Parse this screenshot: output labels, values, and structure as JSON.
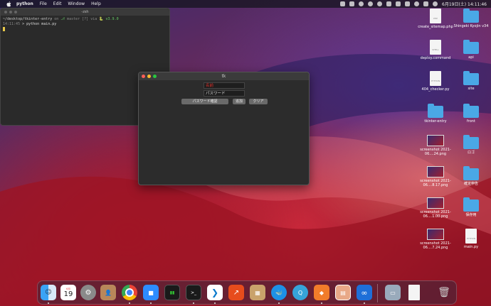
{
  "menubar": {
    "app": "python",
    "items": [
      "File",
      "Edit",
      "Window",
      "Help"
    ],
    "datetime": "6月19日(土)  14:11:46"
  },
  "terminal": {
    "title": "-zsh",
    "line1_path": "~/desktop/tkinter-entry",
    "line1_on": "on",
    "line1_branch": "master [?] via",
    "line1_py": "v3.9.0",
    "line2_time": "14:11:45",
    "line2_cmd": "> python main.py"
  },
  "tk": {
    "title": "tk",
    "entry1": "名前",
    "entry2": "パスワード",
    "btn_confirm": "パスワード確認",
    "btn_add": "追加",
    "btn_clear": "クリア",
    "colors": {
      "entry1_text": "#e0302a",
      "entry2_text": "#dddddd"
    }
  },
  "desktop": [
    {
      "label": "create_sitemap.php",
      "type": "file",
      "tag": "PHP"
    },
    {
      "label": "Shingeki Kyojin v34",
      "type": "folder"
    },
    {
      "label": "deploy.command",
      "type": "file",
      "tag": "SHELL"
    },
    {
      "label": "api",
      "type": "folder"
    },
    {
      "label": "404_checker.py",
      "type": "file",
      "tag": "PYTHON"
    },
    {
      "label": "site",
      "type": "folder"
    },
    {
      "label": "tkinter-entry",
      "type": "folder"
    },
    {
      "label": "front",
      "type": "folder"
    },
    {
      "label": "screenshot 2021-06....24.png",
      "type": "shot"
    },
    {
      "label": "ロゴ",
      "type": "folder"
    },
    {
      "label": "screenshot 2021-06....8.17.png",
      "type": "shot"
    },
    {
      "label": "確定申告",
      "type": "folder"
    },
    {
      "label": "screenshot 2021-06....1.00.png",
      "type": "shot"
    },
    {
      "label": "保存用",
      "type": "folder"
    },
    {
      "label": "screenshot 2021-06....7.24.png",
      "type": "shot"
    },
    {
      "label": "main.py",
      "type": "file",
      "tag": "PYTHON"
    }
  ],
  "dock": {
    "calendar_month": "6月",
    "calendar_day": "19",
    "apps": [
      "finder-icon",
      "calendar-icon",
      "system-preferences-icon",
      "contacts-icon",
      "chrome-icon",
      "zoom-icon",
      "activity-monitor-icon",
      "terminal-icon",
      "vscode-icon",
      "stocks-icon",
      "archive-icon",
      "docker-icon",
      "quicktime-icon",
      "shapes-icon",
      "stickies-icon",
      "infinity-icon",
      "preview-icon",
      "document-icon",
      "trash-icon"
    ],
    "terminal_glyph": ">_"
  }
}
